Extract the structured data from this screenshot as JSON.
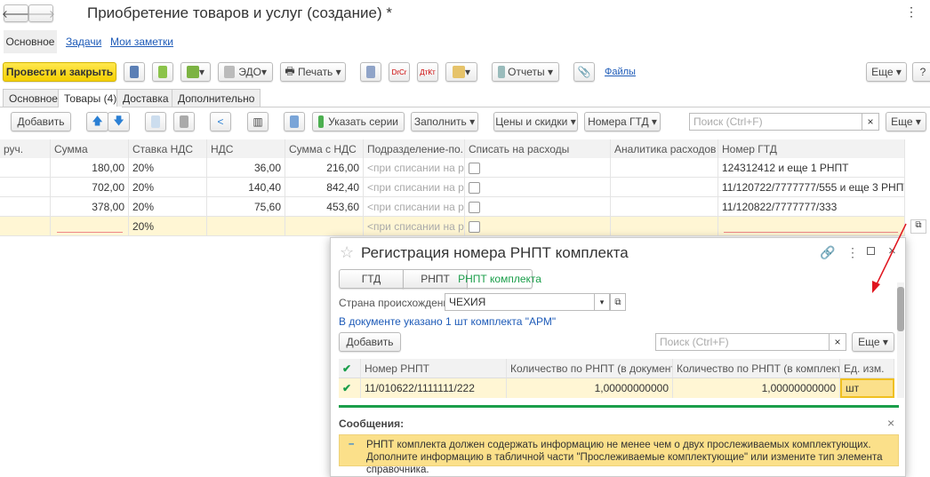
{
  "window": {
    "title": "Приобретение товаров и услуг (создание) *"
  },
  "nav_tabs": [
    "Основное",
    "Задачи",
    "Мои заметки"
  ],
  "toolbar": {
    "post_close": "Провести и закрыть",
    "edo": "ЭДО",
    "print": "Печать",
    "reports": "Отчеты",
    "files": "Файлы",
    "more": "Еще",
    "help": "?"
  },
  "doc_tabs": [
    "Основное",
    "Товары (4)",
    "Доставка",
    "Дополнительно"
  ],
  "table_toolbar": {
    "add": "Добавить",
    "series": "Указать серии",
    "fill": "Заполнить",
    "prices": "Цены и скидки",
    "gtd": "Номера ГТД",
    "search_placeholder": "Поиск (Ctrl+F)",
    "clear": "×",
    "more": "Еще"
  },
  "table": {
    "columns": [
      "руч.",
      "Сумма",
      "Ставка НДС",
      "НДС",
      "Сумма с НДС",
      "Подразделение-по...",
      "Списать на расходы",
      "Аналитика расходов",
      "Номер ГТД"
    ],
    "rows": [
      [
        "",
        "180,00",
        "20%",
        "36,00",
        "216,00",
        "<при списании на р...",
        "",
        "",
        "124312412 и еще 1 РНПТ"
      ],
      [
        "",
        "702,00",
        "20%",
        "140,40",
        "842,40",
        "<при списании на р...",
        "",
        "",
        "11/120722/7777777/555 и еще 3 РНПТ"
      ],
      [
        "",
        "378,00",
        "20%",
        "75,60",
        "453,60",
        "<при списании на р...",
        "",
        "",
        "11/120822/7777777/333"
      ],
      [
        "",
        "",
        "20%",
        "",
        "",
        "<при списании на р...",
        "",
        "",
        ""
      ]
    ]
  },
  "dialog": {
    "title": "Регистрация номера РНПТ комплекта",
    "tabs": [
      "ГТД",
      "РНПТ",
      "РНПТ комплекта"
    ],
    "country_label": "Страна происхождения:",
    "country_value": "ЧЕХИЯ",
    "info": "В документе указано 1 шт комплекта \"АРМ\"",
    "add": "Добавить",
    "search_placeholder": "Поиск (Ctrl+F)",
    "clear": "×",
    "more": "Еще",
    "columns": [
      "Номер РНПТ",
      "Количество по РНПТ (в документе)",
      "Количество по РНПТ (в комплекте)",
      "Ед. изм."
    ],
    "rows": [
      [
        "11/010622/1111111/222",
        "1,00000000000",
        "1,00000000000",
        "шт"
      ]
    ],
    "messages_title": "Сообщения:",
    "message_line1": "РНПТ комплекта должен содержать информацию не менее чем о двух прослеживаемых комплектующих.",
    "message_line2": "Дополните информацию в табличной части \"Прослеживаемые комплектующие\" или измените тип элемента справочника."
  },
  "colors": {
    "accent_yellow": "#f5d000",
    "active_green": "#1a9e4a",
    "link": "#1e5bb8",
    "arrow": "#e0141e"
  }
}
